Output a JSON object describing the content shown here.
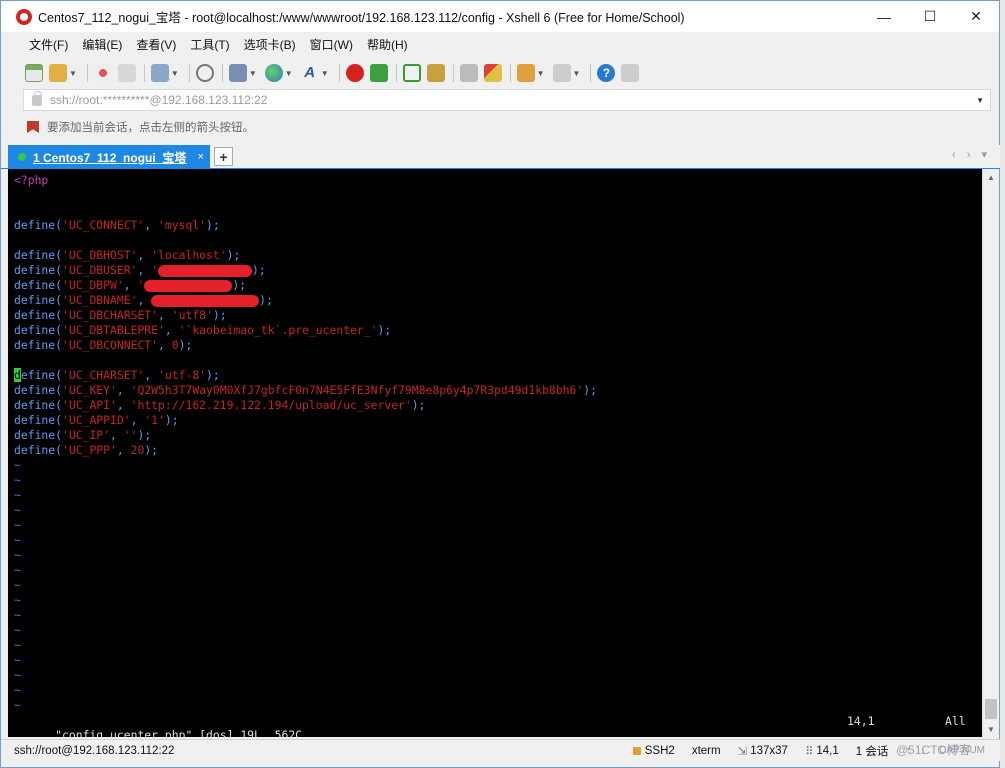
{
  "window": {
    "title": "Centos7_112_nogui_宝塔 - root@localhost:/www/wwwroot/192.168.123.112/config - Xshell 6 (Free for Home/School)",
    "minimize_glyph": "—",
    "maximize_glyph": "☐",
    "close_glyph": "✕"
  },
  "menu": [
    "文件(F)",
    "编辑(E)",
    "查看(V)",
    "工具(T)",
    "选项卡(B)",
    "窗口(W)",
    "帮助(H)"
  ],
  "address": {
    "value": "ssh://root:**********@192.168.123.112:22"
  },
  "hint": "要添加当前会话，点击左侧的箭头按钮。",
  "tab": {
    "label": "1 Centos7_112_nogui_宝塔",
    "close": "×",
    "new": "+"
  },
  "terminal": {
    "php_open": "<?php",
    "lines": [
      {
        "fn": "define",
        "key": "'UC_CONNECT'",
        "val": "'mysql'"
      },
      {
        "fn": "define",
        "key": "'UC_DBHOST'",
        "val": "'localhost'"
      },
      {
        "fn": "define",
        "key": "'UC_DBUSER'",
        "val": "'"
      },
      {
        "fn": "define",
        "key": "'UC_DBPW'",
        "val": "'"
      },
      {
        "fn": "define",
        "key": "'UC_DBNAME'",
        "val": ""
      },
      {
        "fn": "define",
        "key": "'UC_DBCHARSET'",
        "val": "'utf8'"
      },
      {
        "fn": "define",
        "key": "'UC_DBTABLEPRE'",
        "val": "'`kaobeimao_tk`.pre_ucenter_'"
      },
      {
        "fn": "define",
        "key": "'UC_DBCONNECT'",
        "val": "0"
      },
      {
        "fn": "efine",
        "cursor": "d",
        "key": "'UC_CHARSET'",
        "val": "'utf-8'"
      },
      {
        "fn": "define",
        "key": "'UC_KEY'",
        "val": "'Q2W5h3T7Way0M0XfJ7gbfcF0n7N4E5FfE3Nfyf79M8e8p6y4p7R3pd49d1kb8bh6'"
      },
      {
        "fn": "define",
        "key": "'UC_API'",
        "val": "'http://162.219.122.194/upload/uc_server'"
      },
      {
        "fn": "define",
        "key": "'UC_APPID'",
        "val": "'1'"
      },
      {
        "fn": "define",
        "key": "'UC_IP'",
        "val": "''"
      },
      {
        "fn": "define",
        "key": "'UC_PPP'",
        "val": "20"
      }
    ],
    "tilde": "~",
    "status_file": "\"config_ucenter.php\" [dos] 19L, 562C",
    "status_pos": "14,1",
    "status_all": "All"
  },
  "statusbar": {
    "connection": "ssh://root@192.168.123.112:22",
    "protocol": "SSH2",
    "term": "xterm",
    "size": "137x37",
    "cursor": "14,1",
    "sessions": "1 会话",
    "caps": "CAP NUM"
  },
  "watermark": "@51CTO博客",
  "colors": {
    "tab_active": "#1e88e5",
    "terminal_bg": "#000000",
    "fn": "#5a9df0",
    "string": "#c42525"
  }
}
